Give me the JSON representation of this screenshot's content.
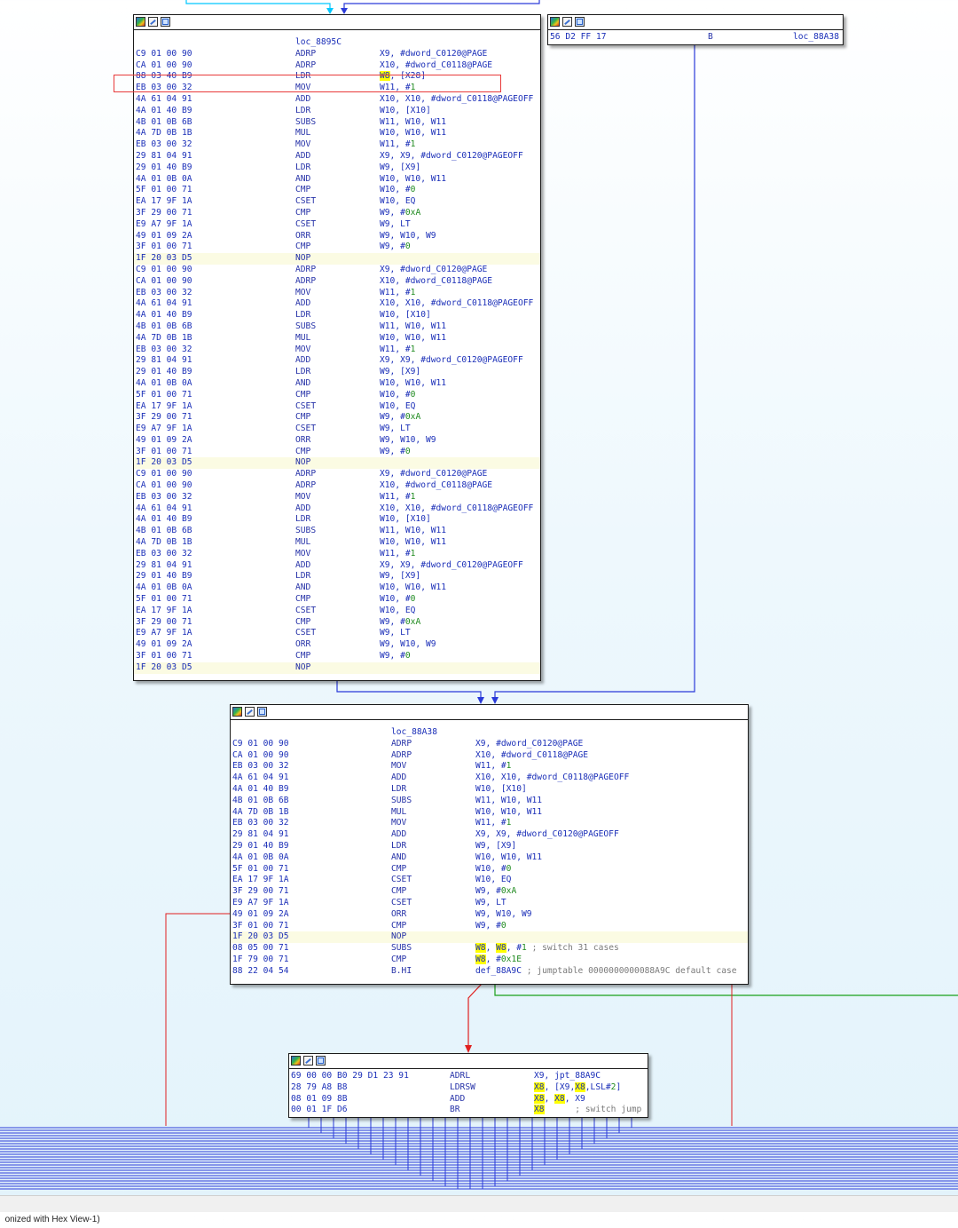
{
  "blocks": {
    "b1": {
      "label": "loc_8895C",
      "rows": [
        {
          "bytes": "C9 01 00 90",
          "mn": "ADRP",
          "op": "X9, #dword_C0120@PAGE"
        },
        {
          "bytes": "CA 01 00 90",
          "mn": "ADRP",
          "op": "X10, #dword_C0118@PAGE"
        },
        {
          "bytes": "88 03 40 B9",
          "mn": "LDR",
          "op": "W8, [X28]"
        },
        {
          "bytes": "EB 03 00 32",
          "mn": "MOV",
          "op": "W11, #1"
        },
        {
          "bytes": "4A 61 04 91",
          "mn": "ADD",
          "op": "X10, X10, #dword_C0118@PAGEOFF"
        },
        {
          "bytes": "4A 01 40 B9",
          "mn": "LDR",
          "op": "W10, [X10]"
        },
        {
          "bytes": "4B 01 0B 6B",
          "mn": "SUBS",
          "op": "W11, W10, W11"
        },
        {
          "bytes": "4A 7D 0B 1B",
          "mn": "MUL",
          "op": "W10, W10, W11"
        },
        {
          "bytes": "EB 03 00 32",
          "mn": "MOV",
          "op": "W11, #1"
        },
        {
          "bytes": "29 81 04 91",
          "mn": "ADD",
          "op": "X9, X9, #dword_C0120@PAGEOFF"
        },
        {
          "bytes": "29 01 40 B9",
          "mn": "LDR",
          "op": "W9, [X9]"
        },
        {
          "bytes": "4A 01 0B 0A",
          "mn": "AND",
          "op": "W10, W10, W11"
        },
        {
          "bytes": "5F 01 00 71",
          "mn": "CMP",
          "op": "W10, #0"
        },
        {
          "bytes": "EA 17 9F 1A",
          "mn": "CSET",
          "op": "W10, EQ"
        },
        {
          "bytes": "3F 29 00 71",
          "mn": "CMP",
          "op": "W9, #0xA"
        },
        {
          "bytes": "E9 A7 9F 1A",
          "mn": "CSET",
          "op": "W9, LT"
        },
        {
          "bytes": "49 01 09 2A",
          "mn": "ORR",
          "op": "W9, W10, W9"
        },
        {
          "bytes": "3F 01 00 71",
          "mn": "CMP",
          "op": "W9, #0"
        },
        {
          "bytes": "1F 20 03 D5",
          "mn": "NOP",
          "op": ""
        },
        {
          "bytes": "C9 01 00 90",
          "mn": "ADRP",
          "op": "X9, #dword_C0120@PAGE"
        },
        {
          "bytes": "CA 01 00 90",
          "mn": "ADRP",
          "op": "X10, #dword_C0118@PAGE"
        },
        {
          "bytes": "EB 03 00 32",
          "mn": "MOV",
          "op": "W11, #1"
        },
        {
          "bytes": "4A 61 04 91",
          "mn": "ADD",
          "op": "X10, X10, #dword_C0118@PAGEOFF"
        },
        {
          "bytes": "4A 01 40 B9",
          "mn": "LDR",
          "op": "W10, [X10]"
        },
        {
          "bytes": "4B 01 0B 6B",
          "mn": "SUBS",
          "op": "W11, W10, W11"
        },
        {
          "bytes": "4A 7D 0B 1B",
          "mn": "MUL",
          "op": "W10, W10, W11"
        },
        {
          "bytes": "EB 03 00 32",
          "mn": "MOV",
          "op": "W11, #1"
        },
        {
          "bytes": "29 81 04 91",
          "mn": "ADD",
          "op": "X9, X9, #dword_C0120@PAGEOFF"
        },
        {
          "bytes": "29 01 40 B9",
          "mn": "LDR",
          "op": "W9, [X9]"
        },
        {
          "bytes": "4A 01 0B 0A",
          "mn": "AND",
          "op": "W10, W10, W11"
        },
        {
          "bytes": "5F 01 00 71",
          "mn": "CMP",
          "op": "W10, #0"
        },
        {
          "bytes": "EA 17 9F 1A",
          "mn": "CSET",
          "op": "W10, EQ"
        },
        {
          "bytes": "3F 29 00 71",
          "mn": "CMP",
          "op": "W9, #0xA"
        },
        {
          "bytes": "E9 A7 9F 1A",
          "mn": "CSET",
          "op": "W9, LT"
        },
        {
          "bytes": "49 01 09 2A",
          "mn": "ORR",
          "op": "W9, W10, W9"
        },
        {
          "bytes": "3F 01 00 71",
          "mn": "CMP",
          "op": "W9, #0"
        },
        {
          "bytes": "1F 20 03 D5",
          "mn": "NOP",
          "op": ""
        },
        {
          "bytes": "C9 01 00 90",
          "mn": "ADRP",
          "op": "X9, #dword_C0120@PAGE"
        },
        {
          "bytes": "CA 01 00 90",
          "mn": "ADRP",
          "op": "X10, #dword_C0118@PAGE"
        },
        {
          "bytes": "EB 03 00 32",
          "mn": "MOV",
          "op": "W11, #1"
        },
        {
          "bytes": "4A 61 04 91",
          "mn": "ADD",
          "op": "X10, X10, #dword_C0118@PAGEOFF"
        },
        {
          "bytes": "4A 01 40 B9",
          "mn": "LDR",
          "op": "W10, [X10]"
        },
        {
          "bytes": "4B 01 0B 6B",
          "mn": "SUBS",
          "op": "W11, W10, W11"
        },
        {
          "bytes": "4A 7D 0B 1B",
          "mn": "MUL",
          "op": "W10, W10, W11"
        },
        {
          "bytes": "EB 03 00 32",
          "mn": "MOV",
          "op": "W11, #1"
        },
        {
          "bytes": "29 81 04 91",
          "mn": "ADD",
          "op": "X9, X9, #dword_C0120@PAGEOFF"
        },
        {
          "bytes": "29 01 40 B9",
          "mn": "LDR",
          "op": "W9, [X9]"
        },
        {
          "bytes": "4A 01 0B 0A",
          "mn": "AND",
          "op": "W10, W10, W11"
        },
        {
          "bytes": "5F 01 00 71",
          "mn": "CMP",
          "op": "W10, #0"
        },
        {
          "bytes": "EA 17 9F 1A",
          "mn": "CSET",
          "op": "W10, EQ"
        },
        {
          "bytes": "3F 29 00 71",
          "mn": "CMP",
          "op": "W9, #0xA"
        },
        {
          "bytes": "E9 A7 9F 1A",
          "mn": "CSET",
          "op": "W9, LT"
        },
        {
          "bytes": "49 01 09 2A",
          "mn": "ORR",
          "op": "W9, W10, W9"
        },
        {
          "bytes": "3F 01 00 71",
          "mn": "CMP",
          "op": "W9, #0"
        },
        {
          "bytes": "1F 20 03 D5",
          "mn": "NOP",
          "op": ""
        }
      ]
    },
    "b2": {
      "label": "",
      "rows": [
        {
          "bytes": "56 D2 FF 17",
          "mn": "B",
          "op": "loc_88A38"
        }
      ]
    },
    "b3": {
      "label": "loc_88A38",
      "rows": [
        {
          "bytes": "C9 01 00 90",
          "mn": "ADRP",
          "op": "X9, #dword_C0120@PAGE"
        },
        {
          "bytes": "CA 01 00 90",
          "mn": "ADRP",
          "op": "X10, #dword_C0118@PAGE"
        },
        {
          "bytes": "EB 03 00 32",
          "mn": "MOV",
          "op": "W11, #1"
        },
        {
          "bytes": "4A 61 04 91",
          "mn": "ADD",
          "op": "X10, X10, #dword_C0118@PAGEOFF"
        },
        {
          "bytes": "4A 01 40 B9",
          "mn": "LDR",
          "op": "W10, [X10]"
        },
        {
          "bytes": "4B 01 0B 6B",
          "mn": "SUBS",
          "op": "W11, W10, W11"
        },
        {
          "bytes": "4A 7D 0B 1B",
          "mn": "MUL",
          "op": "W10, W10, W11"
        },
        {
          "bytes": "EB 03 00 32",
          "mn": "MOV",
          "op": "W11, #1"
        },
        {
          "bytes": "29 81 04 91",
          "mn": "ADD",
          "op": "X9, X9, #dword_C0120@PAGEOFF"
        },
        {
          "bytes": "29 01 40 B9",
          "mn": "LDR",
          "op": "W9, [X9]"
        },
        {
          "bytes": "4A 01 0B 0A",
          "mn": "AND",
          "op": "W10, W10, W11"
        },
        {
          "bytes": "5F 01 00 71",
          "mn": "CMP",
          "op": "W10, #0"
        },
        {
          "bytes": "EA 17 9F 1A",
          "mn": "CSET",
          "op": "W10, EQ"
        },
        {
          "bytes": "3F 29 00 71",
          "mn": "CMP",
          "op": "W9, #0xA"
        },
        {
          "bytes": "E9 A7 9F 1A",
          "mn": "CSET",
          "op": "W9, LT"
        },
        {
          "bytes": "49 01 09 2A",
          "mn": "ORR",
          "op": "W9, W10, W9"
        },
        {
          "bytes": "3F 01 00 71",
          "mn": "CMP",
          "op": "W9, #0"
        },
        {
          "bytes": "1F 20 03 D5",
          "mn": "NOP",
          "op": ""
        },
        {
          "bytes": "08 05 00 71",
          "mn": "SUBS",
          "op": "W8, W8, #1 ; switch 31 cases"
        },
        {
          "bytes": "1F 79 00 71",
          "mn": "CMP",
          "op": "W8, #0x1E"
        },
        {
          "bytes": "88 22 04 54",
          "mn": "B.HI",
          "op": "def_88A9C ; jumptable 0000000000088A9C default case"
        }
      ]
    },
    "b4": {
      "label": "",
      "rows": [
        {
          "bytes": "69 00 00 B0 29 D1 23 91",
          "mn": "ADRL",
          "op": "X9, jpt_88A9C"
        },
        {
          "bytes": "28 79 A8 B8",
          "mn": "LDRSW",
          "op": "X8, [X9,X8,LSL#2]"
        },
        {
          "bytes": "08 01 09 8B",
          "mn": "ADD",
          "op": "X8, X8, X9"
        },
        {
          "bytes": "00 01 1F D6",
          "mn": "BR",
          "op": "X8      ; switch jump"
        }
      ]
    }
  },
  "highlight_register": "W8",
  "highlight_register_b4": "X8",
  "status_text": "onized with Hex View-1)",
  "colors": {
    "edge_normal": "#2a3ad9",
    "edge_cyan": "#00c8ff",
    "edge_false": "#e02020",
    "edge_true": "#1aa01a",
    "highlight_row": "#fbfbe3",
    "register_highlight": "#ffff00",
    "selection_box": "#e83a3a"
  }
}
